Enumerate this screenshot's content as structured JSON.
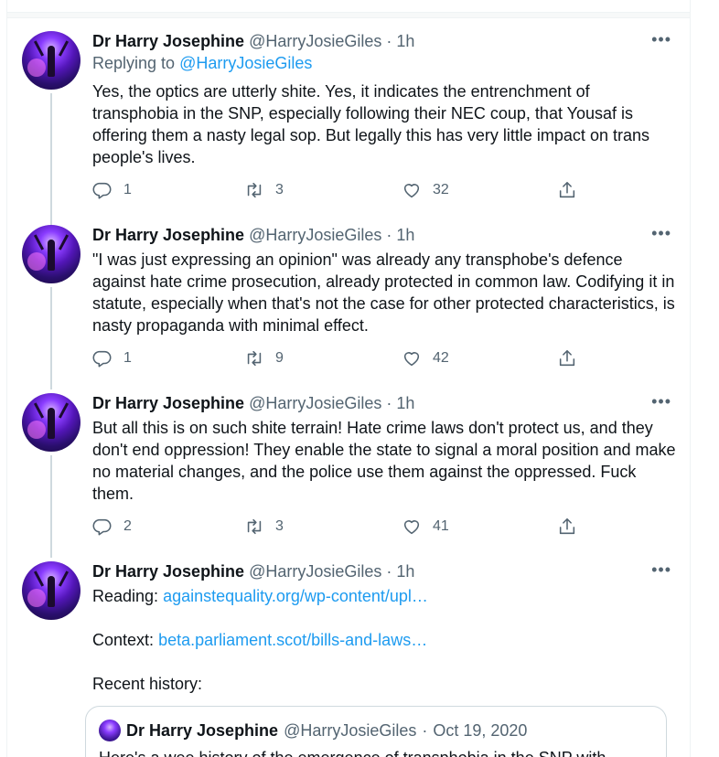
{
  "tweets": [
    {
      "name": "Dr Harry Josephine",
      "handle": "@HarryJosieGiles",
      "dot": "·",
      "time": "1h",
      "reply_prefix": "Replying to",
      "reply_handle": "@HarryJosieGiles",
      "text": "Yes, the optics are utterly shite. Yes, it indicates the entrenchment of transphobia in the SNP, especially following their NEC coup, that Yousaf is offering them a nasty legal sop. But legally this has very little impact on trans people's lives.",
      "replies": "1",
      "retweets": "3",
      "likes": "32"
    },
    {
      "name": "Dr Harry Josephine",
      "handle": "@HarryJosieGiles",
      "dot": "·",
      "time": "1h",
      "text": "\"I was just expressing an opinion\" was already any transphobe's defence against hate crime prosecution, already protected in common law. Codifying it in statute, especially when that's not the case for other protected characteristics, is nasty propaganda with minimal effect.",
      "replies": "1",
      "retweets": "9",
      "likes": "42"
    },
    {
      "name": "Dr Harry Josephine",
      "handle": "@HarryJosieGiles",
      "dot": "·",
      "time": "1h",
      "text": "But all this is on such shite terrain! Hate crime laws don't protect us, and they don't end oppression! They enable the state to signal a moral position and make no material changes, and the police use them against the oppressed. Fuck them.",
      "replies": "2",
      "retweets": "3",
      "likes": "41"
    },
    {
      "name": "Dr Harry Josephine",
      "handle": "@HarryJosieGiles",
      "dot": "·",
      "time": "1h",
      "reading_label": "Reading:",
      "reading_link": "againstequality.org/wp-content/upl…",
      "context_label": "Context:",
      "context_link": "beta.parliament.scot/bills-and-laws…",
      "history_label": "Recent history:"
    }
  ],
  "quote": {
    "name": "Dr Harry Josephine",
    "handle": "@HarryJosieGiles",
    "dot": "·",
    "date": "Oct 19, 2020",
    "text": "Here's a wee history of the emergence of transphobia in the SNP with"
  },
  "icons": {
    "more": "more-icon",
    "reply": "reply-icon",
    "retweet": "retweet-icon",
    "like": "heart-icon",
    "share": "share-icon"
  }
}
